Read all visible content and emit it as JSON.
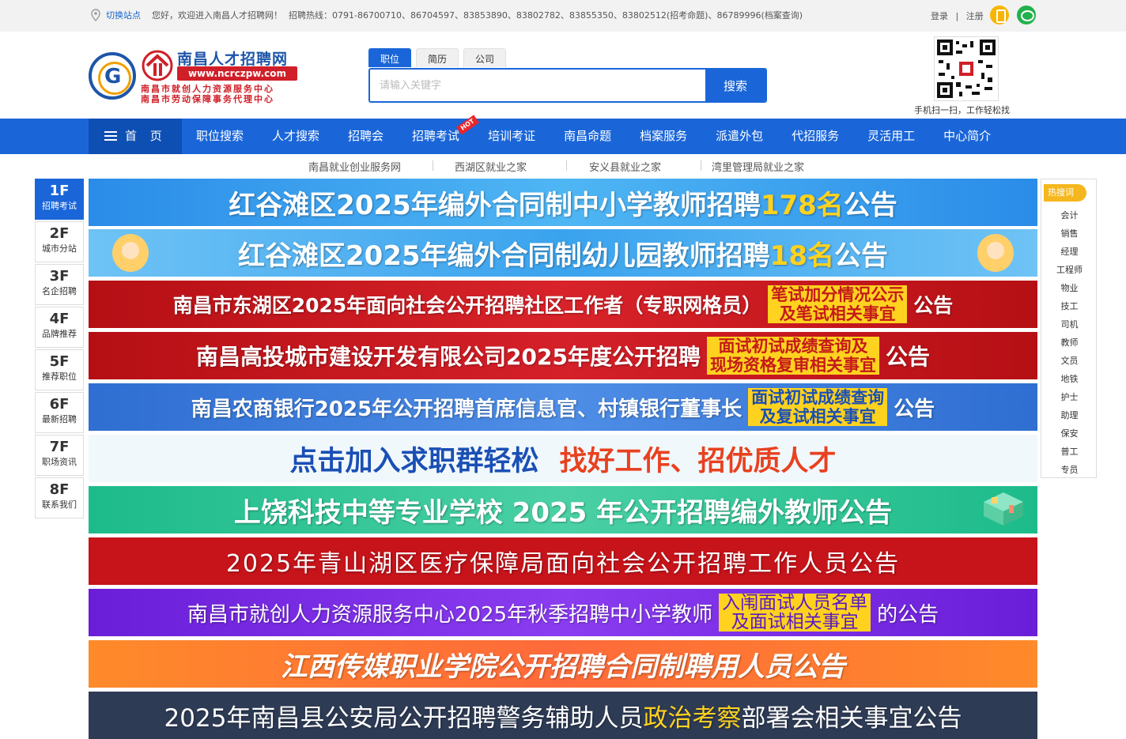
{
  "topbar": {
    "switch_site": "切换站点",
    "welcome": "您好，欢迎进入南昌人才招聘网！",
    "hotline": "招聘热线：0791-86700710、86704597、83853890、83802782、83855350、83802512(招考命题)、86789996(档案查询)",
    "login": "登录",
    "sep": "|",
    "register": "注册"
  },
  "brand": {
    "name": "南昌人才招聘网",
    "url": "www.ncrczpw.com",
    "sub1": "南昌市就创人力资源服务中心",
    "sub2": "南昌市劳动保障事务代理中心",
    "color": "#1d55a8",
    "accent": "#d01f28"
  },
  "search": {
    "tabs": [
      "职位",
      "简历",
      "公司"
    ],
    "placeholder": "请输入关键字",
    "button": "搜索"
  },
  "qr": {
    "caption": "手机扫一扫，工作轻松找"
  },
  "nav": {
    "home": "首 页",
    "items": [
      "职位搜索",
      "人才搜索",
      "招聘会",
      "招聘考试",
      "培训考证",
      "南昌命题",
      "档案服务",
      "派遣外包",
      "代招服务",
      "灵活用工",
      "中心简介"
    ],
    "hot": "HOT"
  },
  "sublinks": [
    "南昌就业创业服务网",
    "西湖区就业之家",
    "安义县就业之家",
    "湾里管理局就业之家"
  ],
  "floors": [
    {
      "num": "1F",
      "label": "招聘考试"
    },
    {
      "num": "2F",
      "label": "城市分站"
    },
    {
      "num": "3F",
      "label": "名企招聘"
    },
    {
      "num": "4F",
      "label": "品牌推荐"
    },
    {
      "num": "5F",
      "label": "推荐职位"
    },
    {
      "num": "6F",
      "label": "最新招聘"
    },
    {
      "num": "7F",
      "label": "职场资讯"
    },
    {
      "num": "8F",
      "label": "联系我们"
    }
  ],
  "banners": {
    "b1": {
      "a": "红谷滩区2025年编外合同制中小学教师招聘",
      "hl": "178名",
      "b": "公告"
    },
    "b2": {
      "a": "红谷滩区2025年编外合同制幼儿园教师招聘",
      "hl": "18名",
      "b": "公告"
    },
    "b3": {
      "a": "南昌市东湖区2025年面向社会公开招聘社区工作者（专职网格员）",
      "hl1": "笔试加分情况公示",
      "hl2": "及笔试相关事宜",
      "b": "公告"
    },
    "b4": {
      "a": "南昌高投城市建设开发有限公司2025年度公开招聘",
      "hl1": "面试初试成绩查询及",
      "hl2": "现场资格复审相关事宜",
      "b": "公告"
    },
    "b5": {
      "a": "南昌农商银行2025年公开招聘首席信息官、村镇银行董事长",
      "hl1": "面试初试成绩查询",
      "hl2": "及复试相关事宜",
      "b": "公告"
    },
    "b6": {
      "a": "点击加入求职群轻松",
      "b": "找好工作、招优质人才"
    },
    "b7": {
      "a": "上饶科技中等专业学校 2025 年公开招聘编外教师公告"
    },
    "b8": {
      "a": "2025年青山湖区医疗保障局面向社会公开招聘工作人员公告"
    },
    "b9": {
      "a": "南昌市就创人力资源服务中心2025年秋季招聘中小学教师",
      "hl1": "入闱面试人员名单",
      "hl2": "及面试相关事宜",
      "b": "的公告"
    },
    "b10": {
      "a": "江西传媒职业学院公开招聘合同制聘用人员公告"
    },
    "b11": {
      "a": "2025年南昌县公安局公开招聘警务辅助人员",
      "hl": "政治考察",
      "b": "部署会相关事宜公告"
    }
  },
  "hotwords": {
    "title": "热搜词",
    "items": [
      "会计",
      "销售",
      "经理",
      "工程师",
      "物业",
      "技工",
      "司机",
      "教师",
      "文员",
      "地铁",
      "护士",
      "助理",
      "保安",
      "普工",
      "专员"
    ]
  }
}
